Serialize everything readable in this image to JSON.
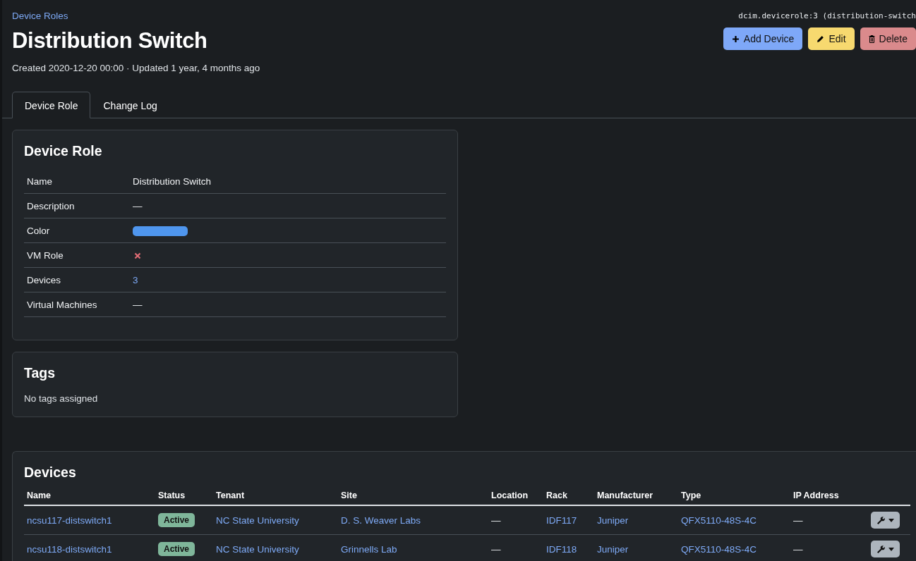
{
  "breadcrumb": "Device Roles",
  "title": "Distribution Switch",
  "meta": "Created 2020-12-20 00:00 · Updated 1 year, 4 months ago",
  "identifier": "dcim.devicerole:3 (distribution-switch",
  "actions": [
    {
      "kind": "add",
      "label": "Add Device"
    },
    {
      "kind": "edit",
      "label": "Edit"
    },
    {
      "kind": "delete",
      "label": "Delete"
    }
  ],
  "tabs": [
    {
      "label": "Device Role",
      "selected": true
    },
    {
      "label": "Change Log",
      "selected": false
    }
  ],
  "device_role": {
    "title": "Device Role",
    "rows": [
      {
        "kind": "text",
        "label": "Name",
        "value": "Distribution Switch"
      },
      {
        "kind": "text",
        "label": "Description",
        "value": "—"
      },
      {
        "kind": "color",
        "label": "Color",
        "color": "#4f96ee"
      },
      {
        "kind": "boolean",
        "label": "VM Role",
        "on": false
      },
      {
        "kind": "link",
        "label": "Devices",
        "value": "3"
      },
      {
        "kind": "text",
        "label": "Virtual Machines",
        "value": "—"
      }
    ]
  },
  "tags": {
    "title": "Tags",
    "empty_text": "No tags assigned"
  },
  "devices": {
    "title": "Devices",
    "columns": [
      "Name",
      "Status",
      "Tenant",
      "Site",
      "Location",
      "Rack",
      "Manufacturer",
      "Type",
      "IP Address"
    ],
    "rows": [
      {
        "name": "ncsu117-distswitch1",
        "status": {
          "label": "Active",
          "color": "#7fb69a"
        },
        "tenant": "NC State University",
        "site": "D. S. Weaver Labs",
        "location": "—",
        "rack": "IDF117",
        "manufacturer": "Juniper",
        "type": "QFX5110-48S-4C",
        "ip_address": "—"
      },
      {
        "name": "ncsu118-distswitch1",
        "status": {
          "label": "Active",
          "color": "#7fb69a"
        },
        "tenant": "NC State University",
        "site": "Grinnells Lab",
        "location": "—",
        "rack": "IDF118",
        "manufacturer": "Juniper",
        "type": "QFX5110-48S-4C",
        "ip_address": "—"
      }
    ]
  }
}
